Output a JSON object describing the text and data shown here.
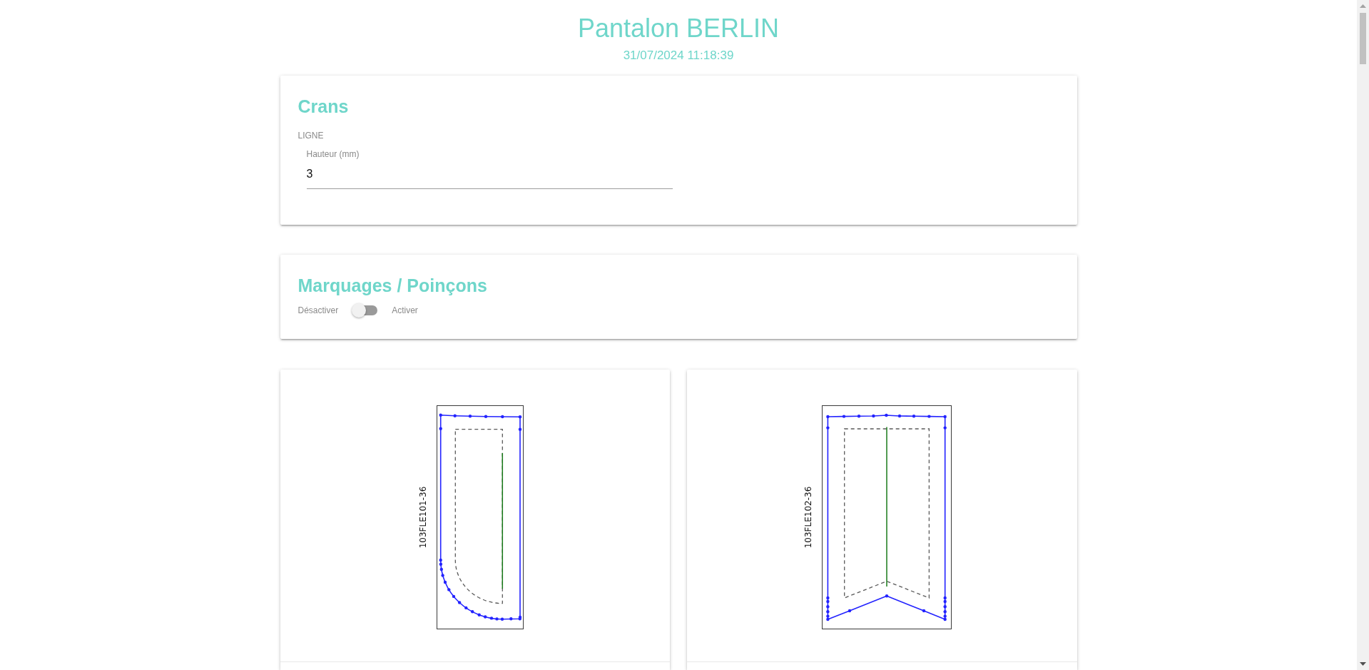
{
  "page": {
    "title": "Pantalon BERLIN",
    "timestamp": "31/07/2024 11:18:39"
  },
  "crans": {
    "title": "Crans",
    "section_label": "LIGNE",
    "height_field": {
      "label": "Hauteur (mm)",
      "value": "3"
    }
  },
  "marquages": {
    "title": "Marquages / Poinçons",
    "off_label": "Désactiver",
    "on_label": "Activer",
    "on": false
  },
  "pieces": [
    {
      "label": "103FLE101-36",
      "kind": "rounded"
    },
    {
      "label": "103FLE102-36",
      "kind": "pointed"
    }
  ]
}
